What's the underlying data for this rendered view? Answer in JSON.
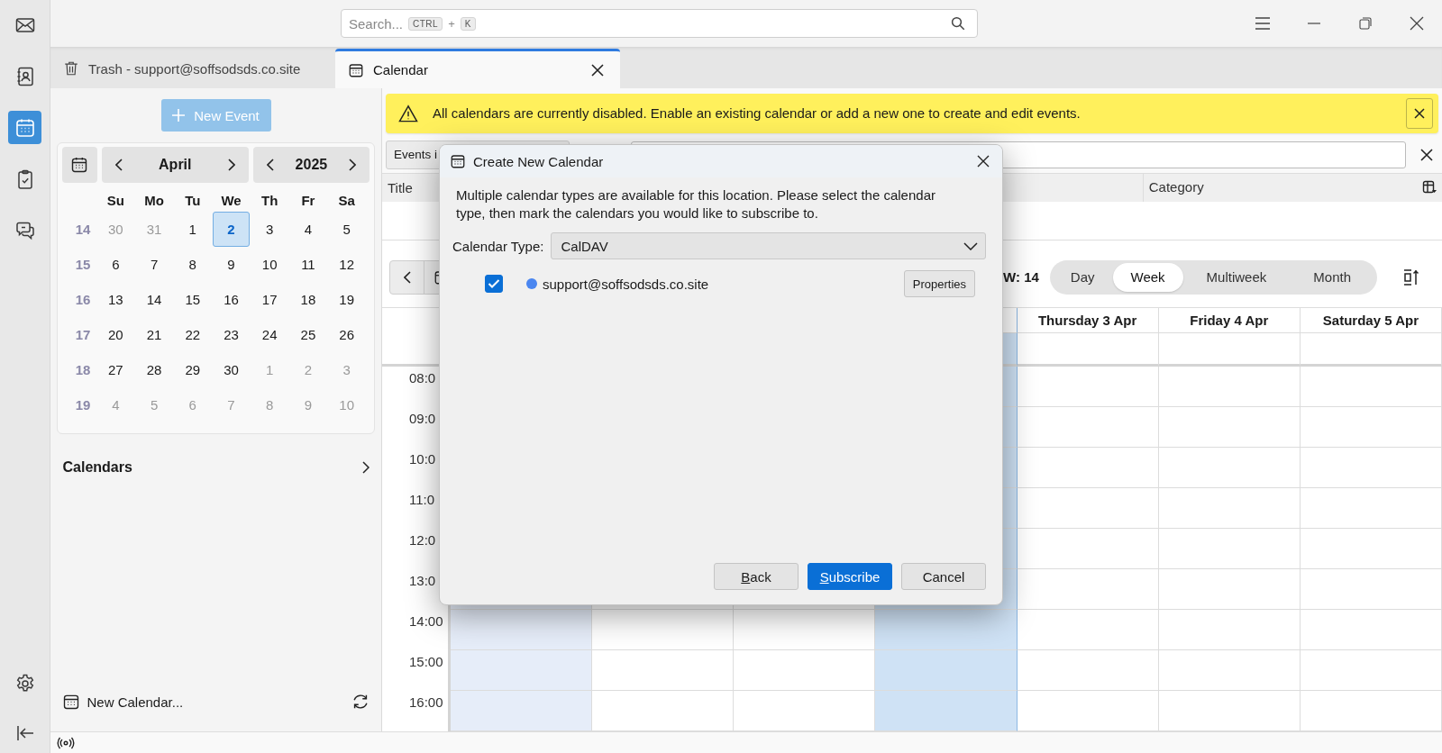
{
  "top_bar": {
    "search": {
      "placeholder": "Search...",
      "shortcut": [
        "CTRL",
        "+",
        "K"
      ]
    }
  },
  "rail": {
    "items": [
      {
        "kind": "mail",
        "selected": false
      },
      {
        "kind": "contacts",
        "selected": false
      },
      {
        "kind": "calendar",
        "selected": true
      },
      {
        "kind": "tasks",
        "selected": false
      },
      {
        "kind": "chat",
        "selected": false
      }
    ]
  },
  "tabs": [
    {
      "kind": "trash",
      "label": "Trash - support@soffsodsds.co.site",
      "selected": false
    },
    {
      "kind": "calendar",
      "label": "Calendar",
      "selected": true
    }
  ],
  "sidebar": {
    "new_event": {
      "label": "New Event",
      "disabled": true
    },
    "minimonth": {
      "month": "April",
      "year": "2025",
      "weekdays": [
        "Su",
        "Mo",
        "Tu",
        "We",
        "Th",
        "Fr",
        "Sa"
      ],
      "weeks": [
        {
          "number": "14",
          "days": [
            {
              "day": "30",
              "other_month": true,
              "selected": false
            },
            {
              "day": "31",
              "other_month": true,
              "selected": false
            },
            {
              "day": "1",
              "other_month": false,
              "selected": false
            },
            {
              "day": "2",
              "other_month": false,
              "selected": true
            },
            {
              "day": "3",
              "other_month": false,
              "selected": false
            },
            {
              "day": "4",
              "other_month": false,
              "selected": false
            },
            {
              "day": "5",
              "other_month": false,
              "selected": false
            }
          ]
        },
        {
          "number": "15",
          "days": [
            {
              "day": "6",
              "other_month": false,
              "selected": false
            },
            {
              "day": "7",
              "other_month": false,
              "selected": false
            },
            {
              "day": "8",
              "other_month": false,
              "selected": false
            },
            {
              "day": "9",
              "other_month": false,
              "selected": false
            },
            {
              "day": "10",
              "other_month": false,
              "selected": false
            },
            {
              "day": "11",
              "other_month": false,
              "selected": false
            },
            {
              "day": "12",
              "other_month": false,
              "selected": false
            }
          ]
        },
        {
          "number": "16",
          "days": [
            {
              "day": "13",
              "other_month": false,
              "selected": false
            },
            {
              "day": "14",
              "other_month": false,
              "selected": false
            },
            {
              "day": "15",
              "other_month": false,
              "selected": false
            },
            {
              "day": "16",
              "other_month": false,
              "selected": false
            },
            {
              "day": "17",
              "other_month": false,
              "selected": false
            },
            {
              "day": "18",
              "other_month": false,
              "selected": false
            },
            {
              "day": "19",
              "other_month": false,
              "selected": false
            }
          ]
        },
        {
          "number": "17",
          "days": [
            {
              "day": "20",
              "other_month": false,
              "selected": false
            },
            {
              "day": "21",
              "other_month": false,
              "selected": false
            },
            {
              "day": "22",
              "other_month": false,
              "selected": false
            },
            {
              "day": "23",
              "other_month": false,
              "selected": false
            },
            {
              "day": "24",
              "other_month": false,
              "selected": false
            },
            {
              "day": "25",
              "other_month": false,
              "selected": false
            },
            {
              "day": "26",
              "other_month": false,
              "selected": false
            }
          ]
        },
        {
          "number": "18",
          "days": [
            {
              "day": "27",
              "other_month": false,
              "selected": false
            },
            {
              "day": "28",
              "other_month": false,
              "selected": false
            },
            {
              "day": "29",
              "other_month": false,
              "selected": false
            },
            {
              "day": "30",
              "other_month": false,
              "selected": false
            },
            {
              "day": "1",
              "other_month": true,
              "selected": false
            },
            {
              "day": "2",
              "other_month": true,
              "selected": false
            },
            {
              "day": "3",
              "other_month": true,
              "selected": false
            }
          ]
        },
        {
          "number": "19",
          "days": [
            {
              "day": "4",
              "other_month": true,
              "selected": false
            },
            {
              "day": "5",
              "other_month": true,
              "selected": false
            },
            {
              "day": "6",
              "other_month": true,
              "selected": false
            },
            {
              "day": "7",
              "other_month": true,
              "selected": false
            },
            {
              "day": "8",
              "other_month": true,
              "selected": false
            },
            {
              "day": "9",
              "other_month": true,
              "selected": false
            },
            {
              "day": "10",
              "other_month": true,
              "selected": false
            }
          ]
        }
      ]
    },
    "calendars_heading": "Calendars",
    "new_calendar": "New Calendar..."
  },
  "notification": {
    "text": "All calendars are currently disabled. Enable an existing calendar or add a new one to create and edit events."
  },
  "filter": {
    "events_button": "Events i"
  },
  "table": {
    "columns": [
      "Title",
      "Category"
    ]
  },
  "week_view": {
    "week_label": "W: 14",
    "views": [
      {
        "label": "Day",
        "selected": false
      },
      {
        "label": "Week",
        "selected": true
      },
      {
        "label": "Multiweek",
        "selected": false
      },
      {
        "label": "Month",
        "selected": false
      }
    ],
    "columns": [
      {
        "tinted": true,
        "today": false
      },
      {
        "tinted": false,
        "today": false
      },
      {
        "tinted": false,
        "today": false
      },
      {
        "tinted": false,
        "today": true
      },
      {
        "header": "Thursday 3 Apr",
        "tinted": false,
        "today": false
      },
      {
        "header": "Friday 4 Apr",
        "tinted": false,
        "today": false
      },
      {
        "header": "Saturday 5 Apr",
        "tinted": false,
        "today": false
      }
    ],
    "hours": [
      "08:0",
      "09:0",
      "10:0",
      "11:0",
      "12:0",
      "13:0",
      "14:00",
      "15:00",
      "16:00"
    ]
  },
  "dialog": {
    "title": "Create New Calendar",
    "description": "Multiple calendar types are available for this location. Please select the calendar type, then mark the calendars you would like to subscribe to.",
    "type_label": "Calendar Type:",
    "type_value": "CalDAV",
    "calendars": [
      {
        "name": "support@soffsodsds.co.site",
        "checked": true,
        "color": "#4a86f0",
        "properties_button": "Properties"
      }
    ],
    "buttons": [
      {
        "label": "Back",
        "kind": "default",
        "underline_first": true
      },
      {
        "label": "Subscribe",
        "kind": "primary",
        "underline_first": true
      },
      {
        "label": "Cancel",
        "kind": "default",
        "underline_first": false
      }
    ]
  }
}
